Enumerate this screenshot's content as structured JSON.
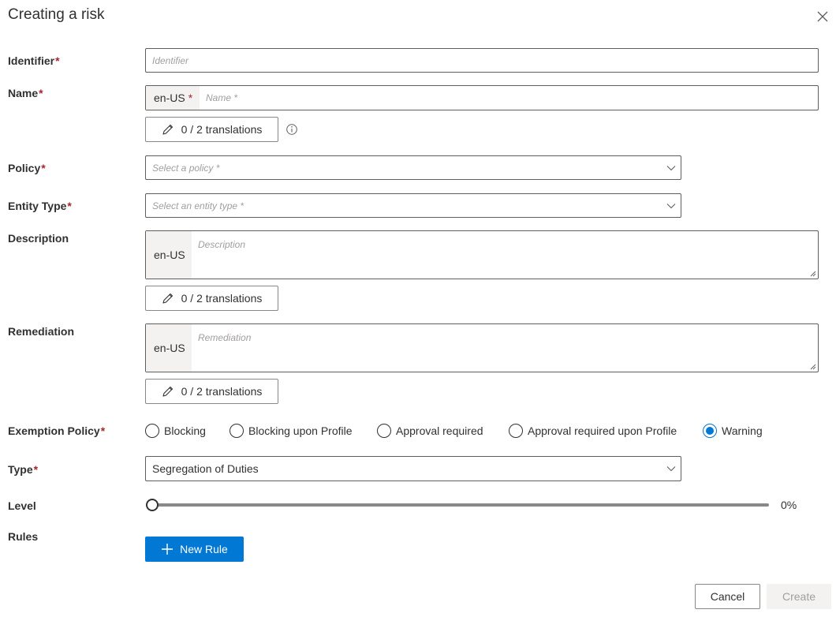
{
  "dialog": {
    "title": "Creating a risk",
    "close_icon": "close-icon"
  },
  "fields": {
    "identifier": {
      "label": "Identifier",
      "required_mark": "*",
      "placeholder": "Identifier",
      "value": ""
    },
    "name": {
      "label": "Name",
      "required_mark": "*",
      "locale": "en-US",
      "locale_required_mark": "*",
      "placeholder": "Name *",
      "value": "",
      "translations_label": "0 / 2 translations",
      "info_icon": "info-icon"
    },
    "policy": {
      "label": "Policy",
      "required_mark": "*",
      "placeholder": "Select a policy *",
      "value": ""
    },
    "entity_type": {
      "label": "Entity Type",
      "required_mark": "*",
      "placeholder": "Select an entity type *",
      "value": ""
    },
    "description": {
      "label": "Description",
      "locale": "en-US",
      "placeholder": "Description",
      "value": "",
      "translations_label": "0 / 2 translations"
    },
    "remediation": {
      "label": "Remediation",
      "locale": "en-US",
      "placeholder": "Remediation",
      "value": "",
      "translations_label": "0 / 2 translations"
    },
    "exemption_policy": {
      "label": "Exemption Policy",
      "required_mark": "*",
      "options": [
        {
          "label": "Blocking",
          "selected": false
        },
        {
          "label": "Blocking upon Profile",
          "selected": false
        },
        {
          "label": "Approval required",
          "selected": false
        },
        {
          "label": "Approval required upon Profile",
          "selected": false
        },
        {
          "label": "Warning",
          "selected": true
        }
      ]
    },
    "type": {
      "label": "Type",
      "required_mark": "*",
      "value": "Segregation of Duties"
    },
    "level": {
      "label": "Level",
      "value_percent": 0,
      "display": "0%"
    },
    "rules": {
      "label": "Rules",
      "new_rule_label": "New Rule"
    }
  },
  "footer": {
    "cancel_label": "Cancel",
    "create_label": "Create",
    "create_enabled": false
  },
  "colors": {
    "accent": "#0078d4",
    "required": "#a4262c",
    "text": "#323130",
    "placeholder": "#a19f9d",
    "disabled_bg": "#f3f2f1",
    "disabled_text": "#a19f9d"
  }
}
